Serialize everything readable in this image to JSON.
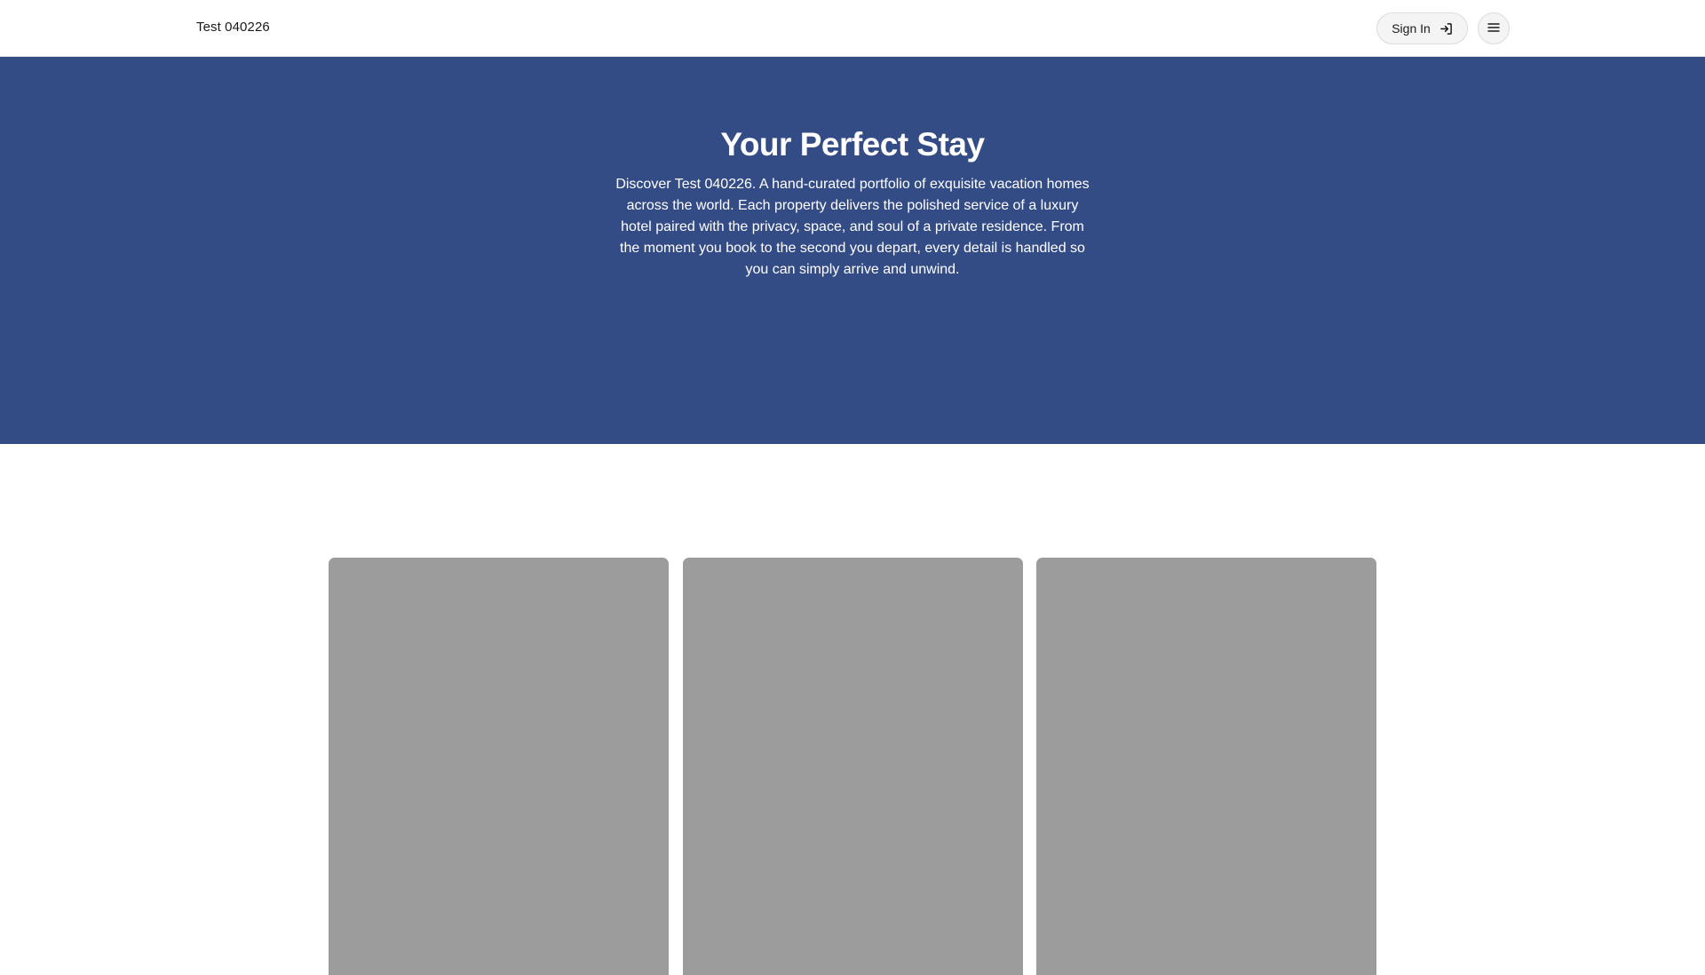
{
  "header": {
    "brand": "Test 040226",
    "signin_label": "Sign In"
  },
  "hero": {
    "title": "Your Perfect Stay",
    "description": "Discover Test 040226. A hand-curated portfolio of exquisite vacation homes across the world. Each property delivers the polished service of a luxury hotel paired with the privacy, space, and soul of a private residence. From the moment you book to the second you depart, every detail is handled so you can simply arrive and unwind."
  },
  "icons": {
    "signin": "sign-in-icon",
    "menu": "hamburger-menu-icon"
  },
  "colors": {
    "hero_background": "#344c85",
    "card_placeholder": "#9c9c9c"
  }
}
